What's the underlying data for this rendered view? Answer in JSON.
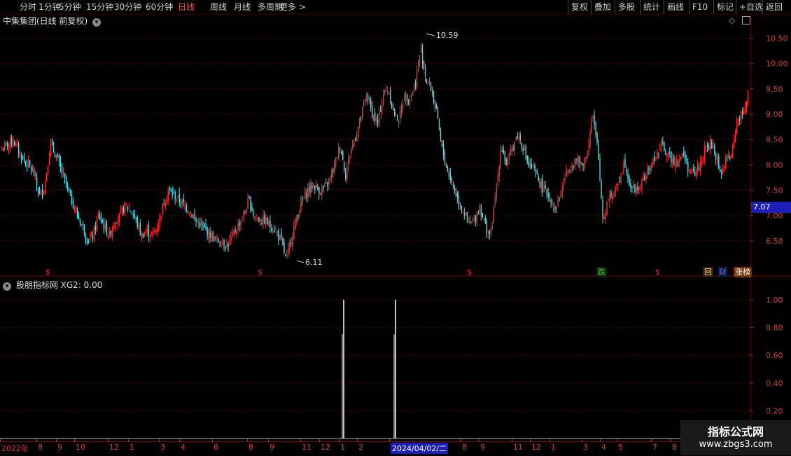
{
  "toolbar": {
    "left_items": [
      "分时",
      "1分钟",
      "5分钟",
      "15分钟",
      "30分钟",
      "60分钟",
      "日线",
      "周线",
      "月线",
      "多周期",
      "更多 >"
    ],
    "active_index": 6,
    "right_items": [
      "复权",
      "叠加",
      "多股",
      "统计",
      "画线",
      "F10",
      "标记",
      "+自选",
      "返回"
    ]
  },
  "main_panel": {
    "title": "中集集团(日线 前复权)",
    "high_label": "10.59",
    "low_label": "6.11",
    "current_price": "7.07",
    "y_ticks": [
      "10.50",
      "10.00",
      "9.50",
      "9.00",
      "8.50",
      "8.00",
      "7.50",
      "7.00",
      "6.50"
    ],
    "markers": [
      {
        "text": "$",
        "color": "#e03030",
        "bg": ""
      },
      {
        "text": "$",
        "color": "#e03030",
        "bg": ""
      },
      {
        "text": "$",
        "color": "#e03030",
        "bg": ""
      },
      {
        "text": "跌",
        "color": "#30e030",
        "bg": "#102010"
      },
      {
        "text": "$",
        "color": "#e03030",
        "bg": ""
      },
      {
        "text": "回",
        "color": "#ffd040",
        "bg": "#302010"
      },
      {
        "text": "财",
        "color": "#5080ff",
        "bg": "#101030"
      },
      {
        "text": "涨榜",
        "color": "#ffffff",
        "bg": "#703000"
      }
    ]
  },
  "indicator_panel": {
    "title": "股朋指标网  XG2: 0.00",
    "y_ticks": [
      "1.00",
      "0.80",
      "0.60",
      "0.40",
      "0.20"
    ]
  },
  "date_axis": {
    "labels": [
      "2022年",
      "8",
      "9",
      "10",
      "12",
      "1",
      "3",
      "4",
      "6",
      "8",
      "9",
      "11",
      "12",
      "1",
      "2",
      "2024/04/02/二",
      "8",
      "9",
      "11",
      "12",
      "1",
      "3",
      "4",
      "5",
      "7",
      "8"
    ],
    "selected": "2024/04/02/二"
  },
  "watermark": {
    "line1": "指标公式网",
    "line2": "www.zbgs3.com"
  },
  "chart_data": {
    "type": "candlestick",
    "ylim": [
      6.0,
      10.7
    ],
    "close_series": [
      8.3,
      8.4,
      8.5,
      8.3,
      8.1,
      8.0,
      7.8,
      7.4,
      7.6,
      8.4,
      8.2,
      7.9,
      7.6,
      7.3,
      7.0,
      6.8,
      6.5,
      6.6,
      7.0,
      6.8,
      6.6,
      6.9,
      7.0,
      7.2,
      7.1,
      6.9,
      6.6,
      6.7,
      6.6,
      6.8,
      7.2,
      7.5,
      7.4,
      7.3,
      7.2,
      7.1,
      6.9,
      6.8,
      6.7,
      6.6,
      6.5,
      6.5,
      6.4,
      6.6,
      6.8,
      7.0,
      7.3,
      7.0,
      6.9,
      6.9,
      6.8,
      6.7,
      6.5,
      6.11,
      6.6,
      7.0,
      7.3,
      7.5,
      7.6,
      7.5,
      7.5,
      7.7,
      8.0,
      8.4,
      7.8,
      8.3,
      8.6,
      9.0,
      9.4,
      9.0,
      8.8,
      9.4,
      9.5,
      9.0,
      8.9,
      9.4,
      9.3,
      9.6,
      10.3,
      9.7,
      9.5,
      9.0,
      8.3,
      7.9,
      7.6,
      7.3,
      7.1,
      6.8,
      6.9,
      7.2,
      6.8,
      6.6,
      7.4,
      8.4,
      8.0,
      8.3,
      8.6,
      8.4,
      8.0,
      7.9,
      7.7,
      7.5,
      7.4,
      7.1,
      7.4,
      7.8,
      8.0,
      8.1,
      8.0,
      8.2,
      9.0,
      8.3,
      6.9,
      7.4,
      7.4,
      7.7,
      8.1,
      7.6,
      7.5,
      7.6,
      7.8,
      8.0,
      8.2,
      8.4,
      8.2,
      8.1,
      8.1,
      8.2,
      7.9,
      7.8,
      8.0,
      8.3,
      8.4,
      8.2,
      7.8,
      8.1,
      8.2,
      8.9,
      9.0,
      9.4
    ],
    "high_point": 10.59,
    "low_point": 6.11,
    "indicator": {
      "name": "XG2",
      "current_value": 0.0,
      "spikes": [
        {
          "index": 65,
          "value": 1.0
        },
        {
          "index": 73,
          "value": 1.0
        }
      ]
    }
  }
}
